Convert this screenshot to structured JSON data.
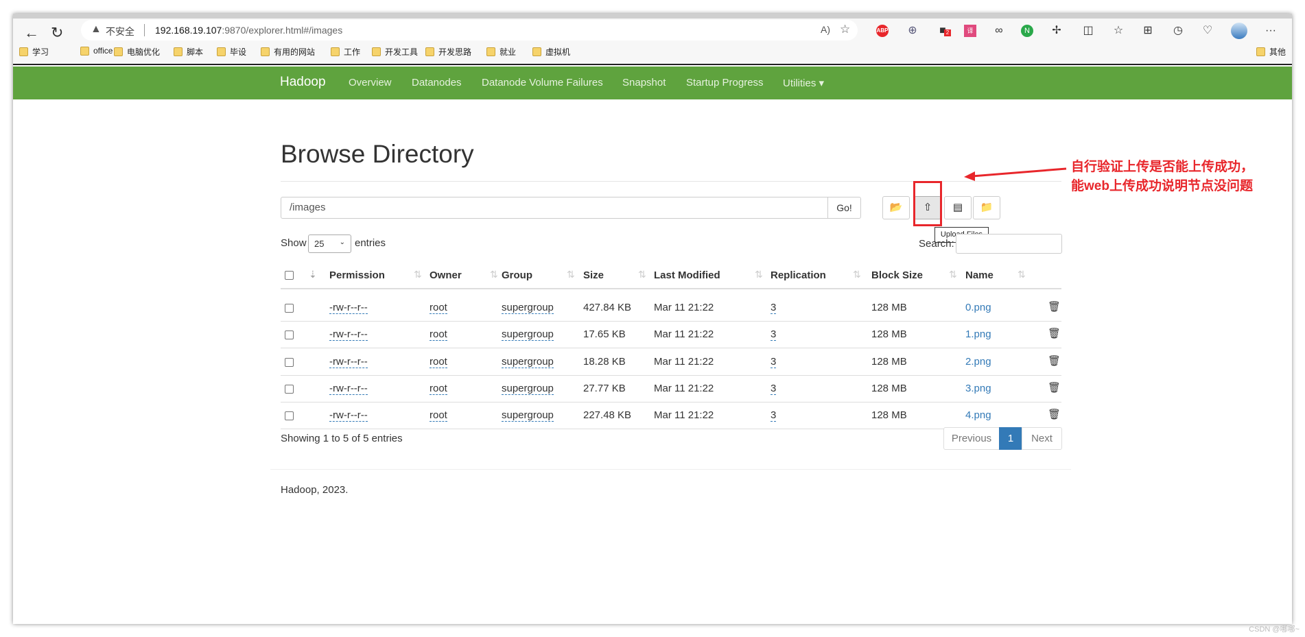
{
  "browser": {
    "address_warning": "不安全",
    "url_host": "192.168.19.107",
    "url_rest": ":9870/explorer.html#/images",
    "bookmarks": [
      "学习",
      "office",
      "电脑优化",
      "脚本",
      "毕设",
      "有用的网站",
      "工作",
      "开发工具",
      "开发思路",
      "就业",
      "虚拟机"
    ],
    "other_bookmarks": "其他",
    "ext_badge": "2",
    "menu": "···"
  },
  "navbar": {
    "brand": "Hadoop",
    "items": [
      "Overview",
      "Datanodes",
      "Datanode Volume Failures",
      "Snapshot",
      "Startup Progress",
      "Utilities ▾"
    ],
    "color": "#5fa33e"
  },
  "page": {
    "title": "Browse Directory",
    "path": "/images",
    "go": "Go!",
    "tooltip": "Upload Files",
    "show": "Show",
    "entries_value": "25",
    "entries": "entries",
    "search": "Search:"
  },
  "table": {
    "headers": [
      "Permission",
      "Owner",
      "Group",
      "Size",
      "Last Modified",
      "Replication",
      "Block Size",
      "Name"
    ],
    "rows": [
      [
        "-rw-r--r--",
        "root",
        "supergroup",
        "427.84 KB",
        "Mar 11 21:22",
        "3",
        "128 MB",
        "0.png"
      ],
      [
        "-rw-r--r--",
        "root",
        "supergroup",
        "17.65 KB",
        "Mar 11 21:22",
        "3",
        "128 MB",
        "1.png"
      ],
      [
        "-rw-r--r--",
        "root",
        "supergroup",
        "18.28 KB",
        "Mar 11 21:22",
        "3",
        "128 MB",
        "2.png"
      ],
      [
        "-rw-r--r--",
        "root",
        "supergroup",
        "27.77 KB",
        "Mar 11 21:22",
        "3",
        "128 MB",
        "3.png"
      ],
      [
        "-rw-r--r--",
        "root",
        "supergroup",
        "227.48 KB",
        "Mar 11 21:22",
        "3",
        "128 MB",
        "4.png"
      ]
    ]
  },
  "footer": {
    "info": "Showing 1 to 5 of 5 entries",
    "prev": "Previous",
    "page": "1",
    "next": "Next",
    "copyright": "Hadoop, 2023."
  },
  "annotation": {
    "line1": "自行验证上传是否能上传成功，",
    "line2": "能web上传成功说明节点没问题",
    "color": "#e8262b"
  },
  "watermark": "CSDN @哪哪~"
}
